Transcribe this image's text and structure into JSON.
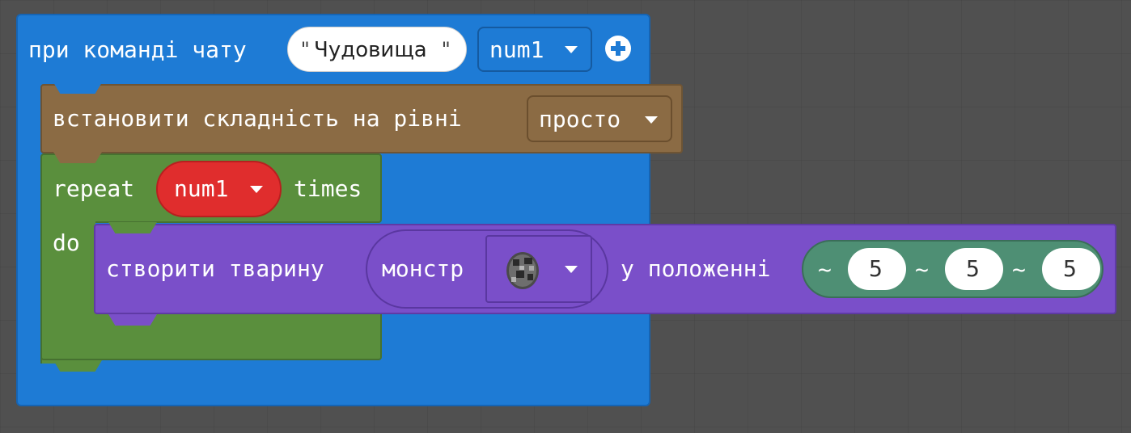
{
  "event_block": {
    "label": "при команді чату",
    "command_value": "Чудовища",
    "quote_open": "\"",
    "quote_close": "\"",
    "param_dropdown": "num1",
    "add_icon": "plus-circle-icon",
    "color": "#1e7bd5"
  },
  "difficulty_block": {
    "label": "встановити складність на рівні",
    "dropdown_value": "просто",
    "color": "#8b6b44"
  },
  "repeat_block": {
    "label_repeat": "repeat",
    "variable": "num1",
    "label_times": "times",
    "label_do": "do",
    "color": "#5a8f3d",
    "variable_color": "#e02d2d"
  },
  "spawn_block": {
    "label": "створити тварину",
    "mob_value": "монстр",
    "mob_icon": "monster-egg-icon",
    "position_label": "у положенні",
    "coord_prefix": "~",
    "coords": [
      "5",
      "5",
      "5"
    ],
    "color": "#7a4fc9",
    "position_color": "#4e8f74"
  }
}
